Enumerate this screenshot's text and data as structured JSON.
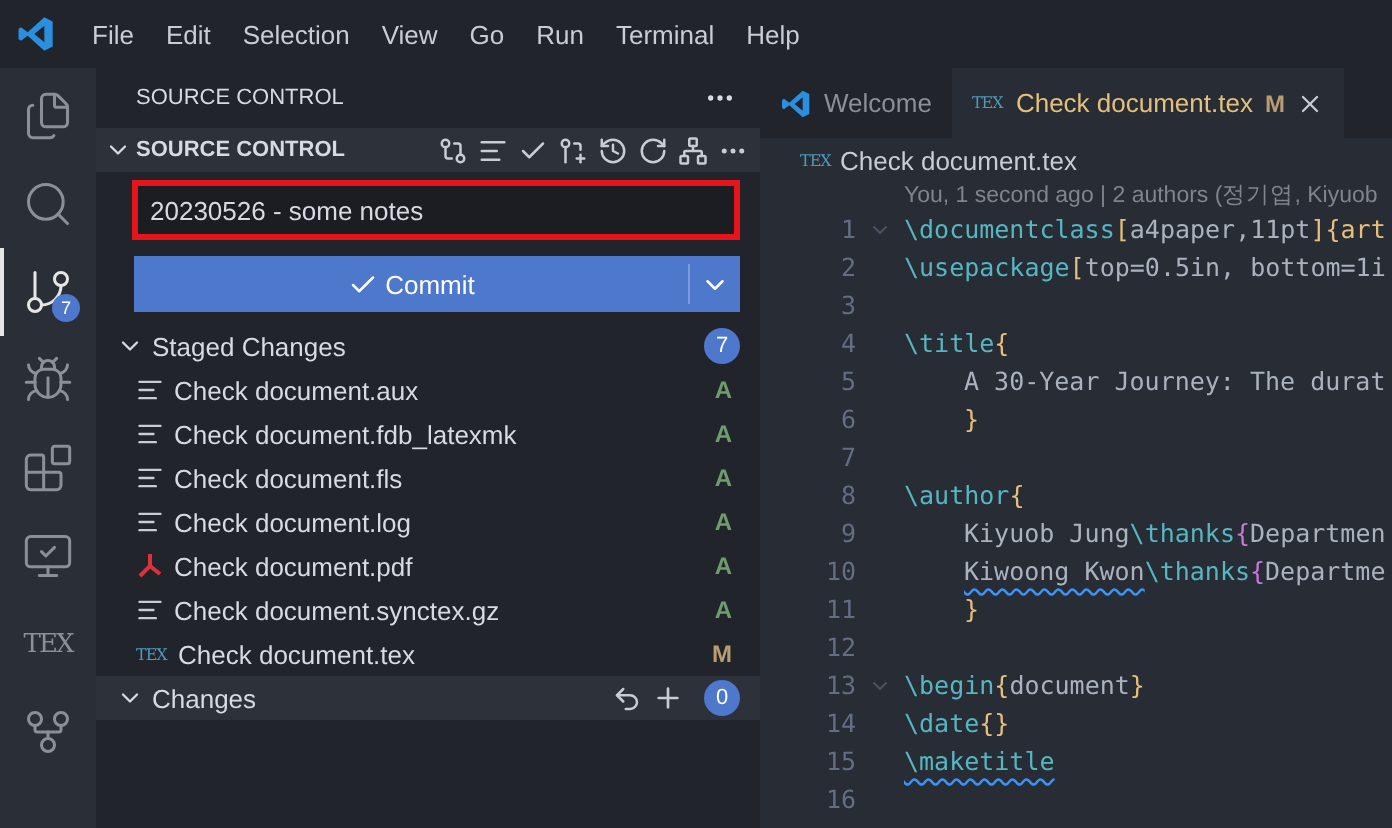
{
  "menu": [
    "File",
    "Edit",
    "Selection",
    "View",
    "Go",
    "Run",
    "Terminal",
    "Help"
  ],
  "activity": [
    {
      "kind": "files",
      "selected": false
    },
    {
      "kind": "search",
      "selected": false
    },
    {
      "kind": "scm",
      "selected": true,
      "badge": "7"
    },
    {
      "kind": "debug",
      "selected": false
    },
    {
      "kind": "extensions",
      "selected": false
    },
    {
      "kind": "remote",
      "selected": false
    },
    {
      "kind": "tex",
      "selected": false,
      "label": "TEX"
    },
    {
      "kind": "graph",
      "selected": false
    }
  ],
  "sidebar": {
    "title": "SOURCE CONTROL",
    "section": "SOURCE CONTROL",
    "expanded": true,
    "commit_message": "20230526 - some notes",
    "highlighted": true,
    "commit_button": "Commit",
    "groups": [
      {
        "title": "Staged Changes",
        "count": "7",
        "expanded": true,
        "files": [
          {
            "name": "Check document.aux",
            "kind": "lines",
            "status": "A"
          },
          {
            "name": "Check document.fdb_latexmk",
            "kind": "lines",
            "status": "A"
          },
          {
            "name": "Check document.fls",
            "kind": "lines",
            "status": "A"
          },
          {
            "name": "Check document.log",
            "kind": "lines",
            "status": "A"
          },
          {
            "name": "Check document.pdf",
            "kind": "pdf",
            "status": "A"
          },
          {
            "name": "Check document.synctex.gz",
            "kind": "lines",
            "status": "A"
          },
          {
            "name": "Check document.tex",
            "kind": "tex",
            "icon_text": "TEX",
            "status": "M"
          }
        ]
      },
      {
        "title": "Changes",
        "count": "0",
        "expanded": true,
        "hovered": true
      }
    ]
  },
  "tabs": [
    {
      "label": "Welcome",
      "kind": "vscode",
      "selected": false
    },
    {
      "label": "Check document.tex",
      "kind": "tex",
      "icon_text": "TEX",
      "status": "M",
      "selected": true
    }
  ],
  "breadcrumb": {
    "icon_text": "TEX",
    "label": "Check document.tex"
  },
  "blame": "You, 1 second ago | 2 authors (정기엽, Kiyuob",
  "code": [
    {
      "n": "1",
      "fold": true,
      "tokens": [
        {
          "t": "\\documentclass",
          "kind": "cmd"
        },
        {
          "t": "[",
          "kind": "b1"
        },
        {
          "t": "a4paper,11pt",
          "kind": "text"
        },
        {
          "t": "]",
          "kind": "b1"
        },
        {
          "t": "{",
          "kind": "b1"
        },
        {
          "t": "art",
          "kind": "arg"
        }
      ]
    },
    {
      "n": "2",
      "fold": false,
      "tokens": [
        {
          "t": "\\usepackage",
          "kind": "cmd"
        },
        {
          "t": "[",
          "kind": "b1"
        },
        {
          "t": "top=0.5in, bottom=1i",
          "kind": "text"
        }
      ]
    },
    {
      "n": "3",
      "fold": false
    },
    {
      "n": "4",
      "fold": false,
      "tokens": [
        {
          "t": "\\title",
          "kind": "cmd"
        },
        {
          "t": "{",
          "kind": "b1"
        }
      ]
    },
    {
      "n": "5",
      "fold": false,
      "indented": true,
      "tokens": [
        {
          "t": "A 30-Year Journey: The durat",
          "kind": "text"
        }
      ]
    },
    {
      "n": "6",
      "fold": false,
      "indented": true,
      "tokens": [
        {
          "t": "}",
          "kind": "b1"
        }
      ]
    },
    {
      "n": "7",
      "fold": false
    },
    {
      "n": "8",
      "fold": false,
      "tokens": [
        {
          "t": "\\author",
          "kind": "cmd"
        },
        {
          "t": "{",
          "kind": "b1"
        }
      ]
    },
    {
      "n": "9",
      "fold": false,
      "indented": true,
      "tokens": [
        {
          "t": "Kiyuob Jung",
          "kind": "text"
        },
        {
          "t": "\\thanks",
          "kind": "cmd"
        },
        {
          "t": "{",
          "kind": "b2"
        },
        {
          "t": "Departmen",
          "kind": "text"
        }
      ]
    },
    {
      "n": "10",
      "fold": false,
      "indented": true,
      "tokens": [
        {
          "t": "Kiwoong Kwon",
          "kind": "spell"
        },
        {
          "t": "\\thanks",
          "kind": "cmd"
        },
        {
          "t": "{",
          "kind": "b2"
        },
        {
          "t": "Departme",
          "kind": "text"
        }
      ]
    },
    {
      "n": "11",
      "fold": false,
      "indented": true,
      "tokens": [
        {
          "t": "}",
          "kind": "b1"
        }
      ]
    },
    {
      "n": "12",
      "fold": false
    },
    {
      "n": "13",
      "fold": true,
      "tokens": [
        {
          "t": "\\begin",
          "kind": "cmd"
        },
        {
          "t": "{",
          "kind": "b1"
        },
        {
          "t": "document",
          "kind": "text"
        },
        {
          "t": "}",
          "kind": "b1"
        }
      ]
    },
    {
      "n": "14",
      "fold": false,
      "tokens": [
        {
          "t": "\\date",
          "kind": "cmd"
        },
        {
          "t": "{}",
          "kind": "b1"
        }
      ]
    },
    {
      "n": "15",
      "fold": false,
      "tokens": [
        {
          "t": "\\maketitle",
          "kind": "cmdspell"
        }
      ]
    },
    {
      "n": "16",
      "fold": false
    }
  ]
}
